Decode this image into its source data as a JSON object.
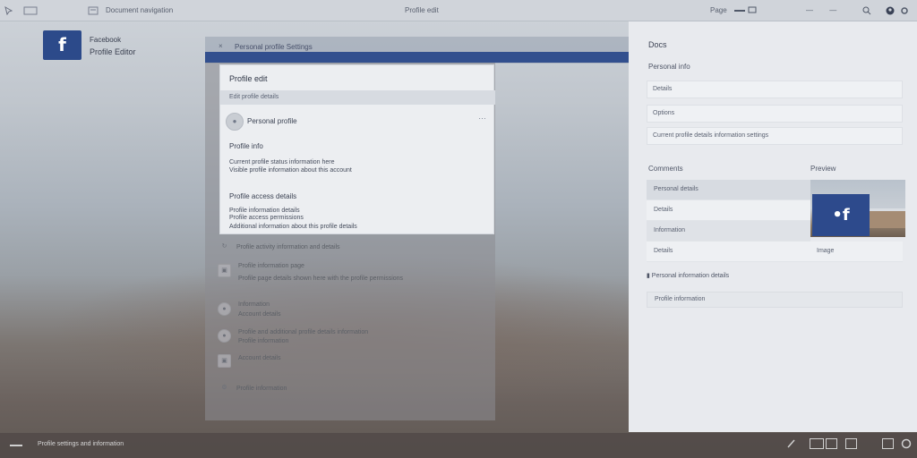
{
  "topbar": {
    "left_title": "Document navigation",
    "center_title": "Profile edit",
    "right_label": "Page",
    "right_indicator": "— —"
  },
  "brand": {
    "logo_glyph": "f",
    "title": "Facebook",
    "subtitle": "Profile Editor"
  },
  "dialog": {
    "title": "Personal profile Settings",
    "close": "×",
    "card": {
      "heading": "Profile edit",
      "subbar": "Edit profile details",
      "name": "Personal profile",
      "more": "…",
      "section1_title": "Profile info",
      "section1_lines": [
        "Current profile status information here",
        "Visible profile information about this account"
      ],
      "section2_title": "Profile access details",
      "section2_lines": [
        "Profile information details",
        "Profile access permissions",
        "Additional information about this profile details"
      ]
    },
    "list": [
      {
        "icon": "↻",
        "label": "Profile activity information and details"
      },
      {
        "icon": "▣",
        "label": "Profile information page",
        "sub": "Profile page details shown here with the profile permissions"
      },
      {
        "icon": "●",
        "label": "Information",
        "sub": "Account details"
      },
      {
        "icon": "●",
        "label": "Profile and additional profile details information",
        "sub": "Profile information"
      },
      {
        "icon": "▣",
        "label": "Account details"
      },
      {
        "icon": "⚙",
        "label": "Profile information"
      }
    ]
  },
  "right": {
    "title": "Docs",
    "section_label": "Personal info",
    "fields": [
      "Details",
      "Options",
      "Current profile details information settings"
    ],
    "table_label": "Comments",
    "image_label": "Preview",
    "table_rows": [
      "Personal details",
      "Details",
      "Information",
      "Details"
    ],
    "image_caption": "Image",
    "thumb_logo": "•f",
    "link": "Personal information details",
    "footer": "Profile information"
  },
  "taskbar": {
    "left_item": "Profile settings and information"
  },
  "colors": {
    "facebook_blue": "#2c4a8a",
    "panel_bg": "#e8eaee"
  }
}
